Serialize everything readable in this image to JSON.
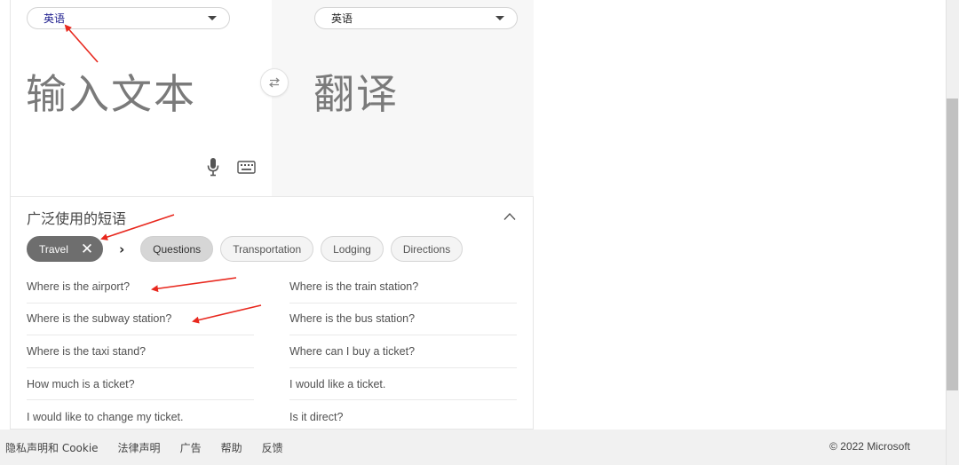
{
  "source_lang": {
    "label": "英语"
  },
  "target_lang": {
    "label": "英语"
  },
  "input": {
    "placeholder": "输入文本"
  },
  "output": {
    "placeholder": "翻译"
  },
  "phrases": {
    "title": "广泛使用的短语",
    "category_chip": "Travel",
    "subcategories": [
      "Questions",
      "Transportation",
      "Lodging",
      "Directions"
    ],
    "selected_subcategory": "Questions",
    "left_column": [
      "Where is the airport?",
      "Where is the subway station?",
      "Where is the taxi stand?",
      "How much is a ticket?",
      "I would like to change my ticket."
    ],
    "right_column": [
      "Where is the train station?",
      "Where is the bus station?",
      "Where can I buy a ticket?",
      "I would like a ticket.",
      "Is it direct?"
    ]
  },
  "footer": {
    "links": [
      "隐私声明和 Cookie",
      "法律声明",
      "广告",
      "帮助",
      "反馈"
    ],
    "copyright": "© 2022 Microsoft"
  },
  "icons": {
    "swap": "swap-icon",
    "mic": "microphone-icon",
    "keyboard": "keyboard-icon",
    "collapse": "chevron-up-icon",
    "clear": "close-icon",
    "next": "chevron-right-icon"
  },
  "colors": {
    "annotation_arrow": "#e8281e",
    "active_chip": "#6e6e6e",
    "selected_chip": "#d6d6d6"
  }
}
